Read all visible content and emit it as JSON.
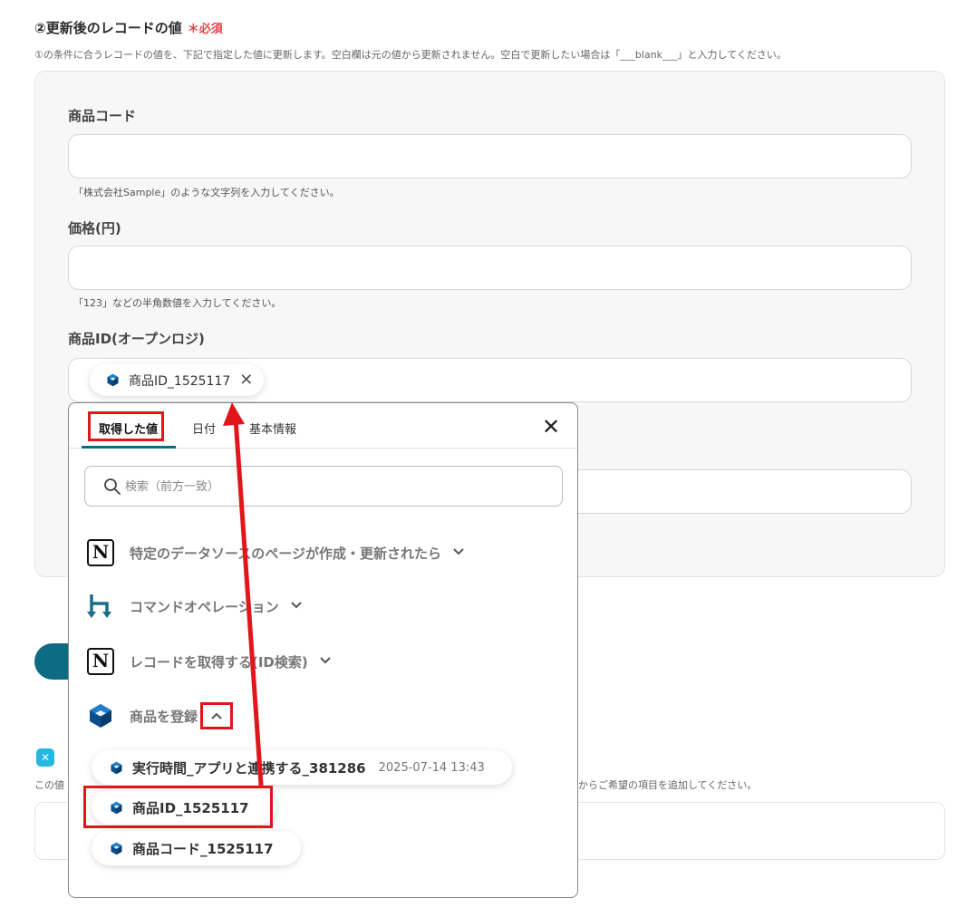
{
  "section": {
    "title": "②更新後のレコードの値",
    "required": "＊必須",
    "description": "①の条件に合うレコードの値を、下記で指定した値に更新します。空白欄は元の値から更新されません。空白で更新したい場合は「___blank___」と入力してください。"
  },
  "fields": {
    "product_code": {
      "label": "商品コード",
      "value": "",
      "hint": "「株式会社Sample」のような文字列を入力してください。"
    },
    "price": {
      "label": "価格(円)",
      "value": "",
      "hint": "「123」などの半角数値を入力してください。"
    },
    "product_id": {
      "label": "商品ID(オープンロジ)",
      "chip": "商品ID_1525117"
    }
  },
  "background": {
    "description_left": "この値",
    "description_right": "からご希望の項目を追加してください。"
  },
  "dropdown": {
    "tabs": [
      "取得した値",
      "日付",
      "基本情報"
    ],
    "search_placeholder": "検索（前方一致）",
    "groups": [
      {
        "label": "特定のデータソースのページが作成・更新されたら",
        "icon": "notion-icon"
      },
      {
        "label": "コマンドオペレーション",
        "icon": "command-branch-icon"
      },
      {
        "label": "レコードを取得する(ID検索)",
        "icon": "notion-icon"
      },
      {
        "label": "商品を登録",
        "icon": "openlogi-cube-icon"
      }
    ],
    "items": [
      {
        "label": "実行時間_アプリと連携する_381286",
        "meta": "2025-07-14 13:43"
      },
      {
        "label": "商品ID_1525117",
        "meta": ""
      },
      {
        "label": "商品コード_1525117",
        "meta": ""
      }
    ]
  },
  "colors": {
    "accent": "#0f6a84",
    "required": "#e0434b",
    "annotation": "#e0161b"
  }
}
